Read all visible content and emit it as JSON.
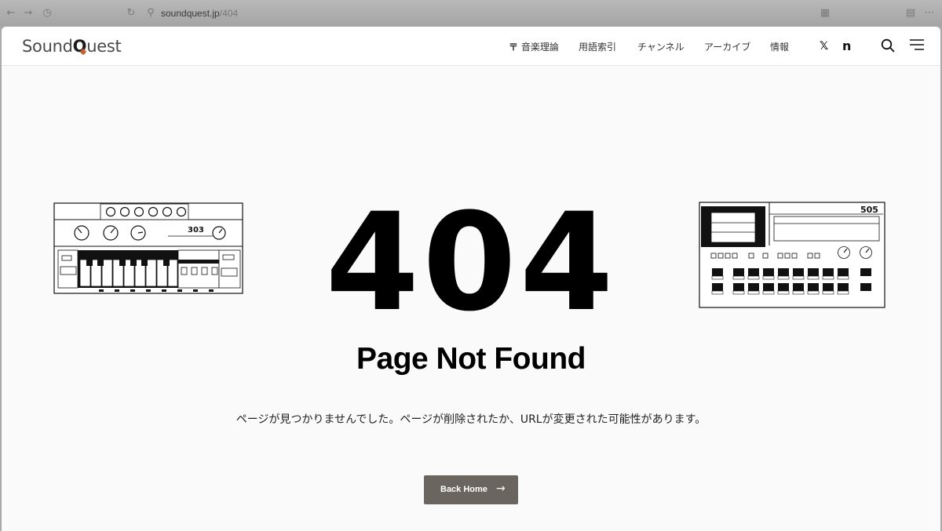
{
  "browser": {
    "url_host": "soundquest.jp",
    "url_path": "/404",
    "icons": [
      "back-arrow-icon",
      "forward-arrow-icon",
      "history-icon",
      "reload-icon",
      "site-info-icon",
      "reader-icon",
      "extensions-icon",
      "more-icon"
    ]
  },
  "header": {
    "logo_prefix": "Sound",
    "logo_q": "Q",
    "logo_suffix": "uest",
    "nav": [
      "音楽理論",
      "用語索引",
      "チャンネル",
      "アーカイブ",
      "情報"
    ],
    "social": {
      "x_label": "𝕏",
      "note_label": "n"
    }
  },
  "main": {
    "code": "404",
    "title": "Page Not Found",
    "message": "ページが見つかりませんでした。ページが削除されたか、URLが変更された可能性があります。",
    "button_label": "Back Home",
    "button_arrow": "→"
  },
  "illustrations": {
    "left_model": "303",
    "right_model": "505"
  },
  "colors": {
    "page_bg": "#fafafa",
    "button_bg": "#6b6560",
    "logo_accent": "#c8612c"
  }
}
